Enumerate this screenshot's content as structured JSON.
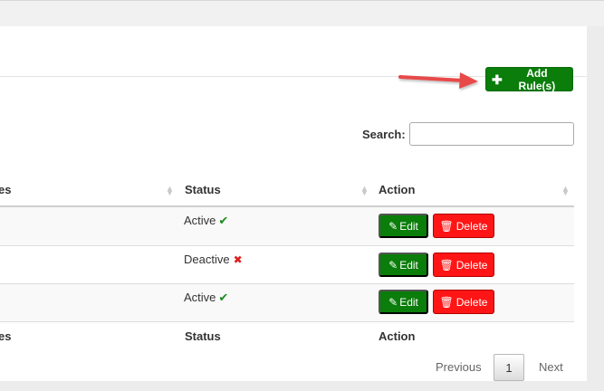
{
  "toolbar": {
    "add_rule_label": "Add Rule(s)"
  },
  "search": {
    "label": "Search:",
    "value": ""
  },
  "table": {
    "header": {
      "col1_partial": "es",
      "status": "Status",
      "action": "Action"
    },
    "footer": {
      "col1_partial": "es",
      "status": "Status",
      "action": "Action"
    },
    "rows": [
      {
        "status": "Active",
        "status_icon": "check-icon"
      },
      {
        "status": "Deactive",
        "status_icon": "cross-icon"
      },
      {
        "status": "Active",
        "status_icon": "check-icon"
      }
    ],
    "edit_label": "Edit",
    "delete_label": "Delete"
  },
  "pagination": {
    "previous": "Previous",
    "page": "1",
    "next": "Next"
  },
  "colors": {
    "success": "#0a7d0a",
    "danger": "#ff1515",
    "arrow": "#e84a4a",
    "check": "#1a8c1a",
    "cross": "#e02020"
  },
  "icons": {
    "add": "plus-icon",
    "edit": "edit-icon",
    "delete": "trash-icon",
    "sort": "sort-icon",
    "pointer": "red-arrow"
  }
}
